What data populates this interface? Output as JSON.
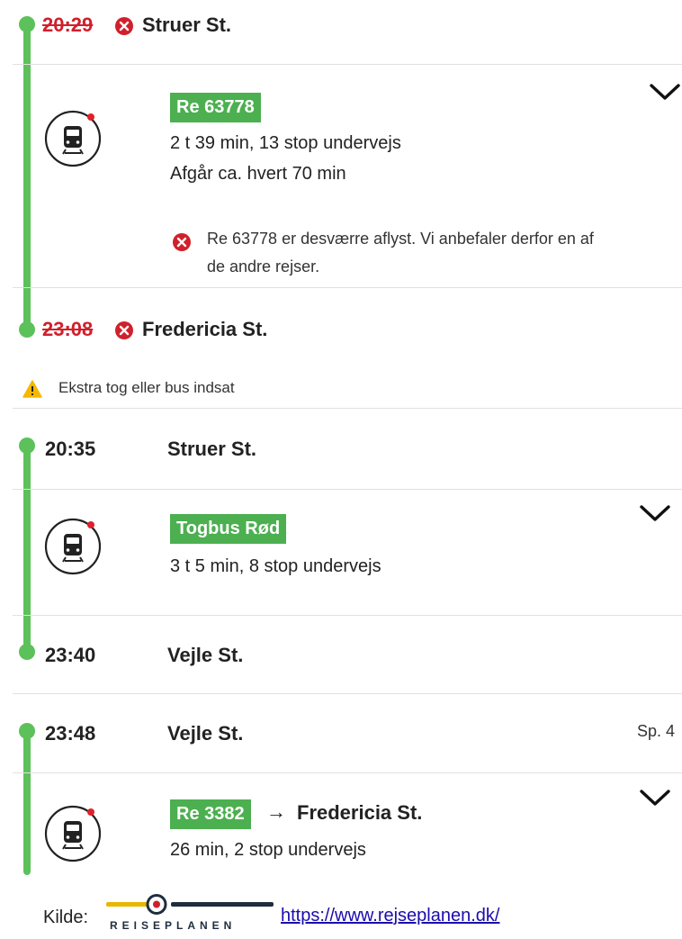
{
  "colors": {
    "route_line": "#5cc15a",
    "badge": "#4caf50",
    "cancel": "#d0202c",
    "warning": "#f5b800"
  },
  "journey1": {
    "departure": {
      "time": "20:29",
      "stop": "Struer St.",
      "cancelled": true
    },
    "leg": {
      "train": "Re 63778",
      "duration": "2 t 39 min, 13 stop undervejs",
      "frequency": "Afgår ca. hvert 70 min",
      "alert_line1": "Re 63778 er desværre aflyst. Vi anbefaler derfor en af",
      "alert_line2": "de andre rejser.",
      "icon": "train-icon"
    },
    "arrival": {
      "time": "23:08",
      "stop": "Fredericia St.",
      "cancelled": true
    }
  },
  "notice": {
    "text": "Ekstra tog eller bus indsat",
    "icon": "warning-icon"
  },
  "journey2": {
    "departure": {
      "time": "20:35",
      "stop": "Struer St."
    },
    "leg": {
      "train": "Togbus Rød",
      "duration": "3 t 5 min, 8 stop undervejs",
      "icon": "train-icon"
    },
    "arrival": {
      "time": "23:40",
      "stop": "Vejle St."
    }
  },
  "journey3": {
    "departure": {
      "time": "23:48",
      "stop": "Vejle St.",
      "platform": "Sp. 4"
    },
    "leg": {
      "train": "Re 3382",
      "arrow": "→",
      "destination": "Fredericia St.",
      "duration": "26 min, 2 stop undervejs",
      "icon": "train-icon"
    }
  },
  "footer": {
    "source_label": "Kilde:",
    "logo_text": "REISEPLANEN",
    "url": "https://www.rejseplanen.dk/"
  }
}
